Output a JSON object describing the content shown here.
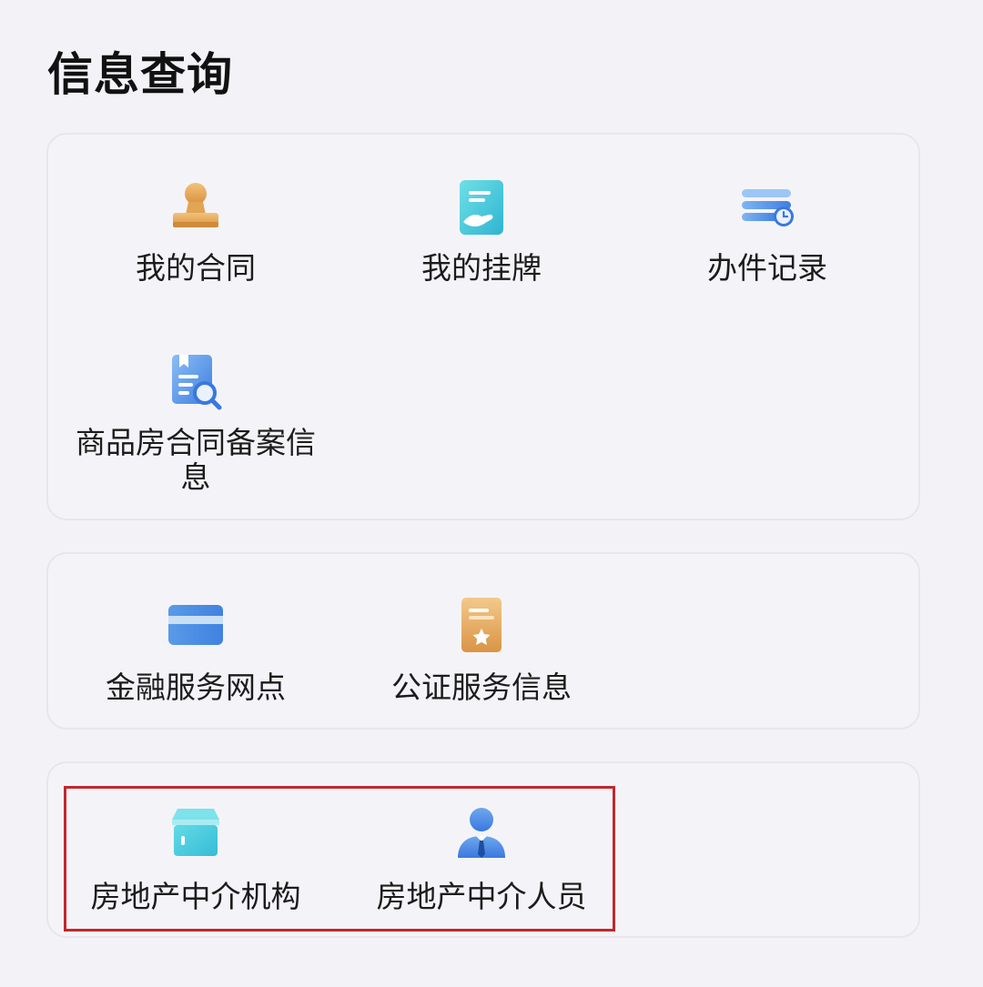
{
  "page": {
    "title": "信息查询"
  },
  "cards": [
    {
      "items": [
        {
          "label": "我的合同",
          "icon": "contract-stamp-icon"
        },
        {
          "label": "我的挂牌",
          "icon": "listing-hand-icon"
        },
        {
          "label": "办件记录",
          "icon": "records-clock-icon"
        },
        {
          "label": "商品房合同备案信息",
          "icon": "document-search-icon"
        }
      ]
    },
    {
      "items": [
        {
          "label": "金融服务网点",
          "icon": "bank-card-icon"
        },
        {
          "label": "公证服务信息",
          "icon": "certificate-star-icon"
        }
      ]
    },
    {
      "items": [
        {
          "label": "房地产中介机构",
          "icon": "agency-shop-icon"
        },
        {
          "label": "房地产中介人员",
          "icon": "agent-person-icon"
        }
      ]
    }
  ],
  "colors": {
    "background": "#f2f2f7",
    "card": "#f4f4f8",
    "highlight": "#c0282d",
    "orange": "#e0a050",
    "cyan": "#45c8d8",
    "blue": "#4a8fe6"
  }
}
